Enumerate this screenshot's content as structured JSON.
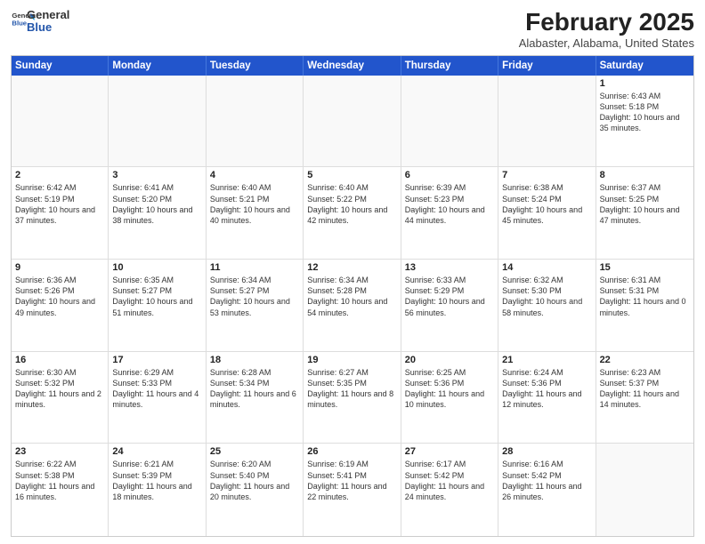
{
  "header": {
    "logo": {
      "general": "General",
      "blue": "Blue"
    },
    "title": "February 2025",
    "location": "Alabaster, Alabama, United States"
  },
  "calendar": {
    "weekdays": [
      "Sunday",
      "Monday",
      "Tuesday",
      "Wednesday",
      "Thursday",
      "Friday",
      "Saturday"
    ],
    "rows": [
      [
        {
          "day": "",
          "sunrise": "",
          "sunset": "",
          "daylight": ""
        },
        {
          "day": "",
          "sunrise": "",
          "sunset": "",
          "daylight": ""
        },
        {
          "day": "",
          "sunrise": "",
          "sunset": "",
          "daylight": ""
        },
        {
          "day": "",
          "sunrise": "",
          "sunset": "",
          "daylight": ""
        },
        {
          "day": "",
          "sunrise": "",
          "sunset": "",
          "daylight": ""
        },
        {
          "day": "",
          "sunrise": "",
          "sunset": "",
          "daylight": ""
        },
        {
          "day": "1",
          "sunrise": "Sunrise: 6:43 AM",
          "sunset": "Sunset: 5:18 PM",
          "daylight": "Daylight: 10 hours and 35 minutes."
        }
      ],
      [
        {
          "day": "2",
          "sunrise": "Sunrise: 6:42 AM",
          "sunset": "Sunset: 5:19 PM",
          "daylight": "Daylight: 10 hours and 37 minutes."
        },
        {
          "day": "3",
          "sunrise": "Sunrise: 6:41 AM",
          "sunset": "Sunset: 5:20 PM",
          "daylight": "Daylight: 10 hours and 38 minutes."
        },
        {
          "day": "4",
          "sunrise": "Sunrise: 6:40 AM",
          "sunset": "Sunset: 5:21 PM",
          "daylight": "Daylight: 10 hours and 40 minutes."
        },
        {
          "day": "5",
          "sunrise": "Sunrise: 6:40 AM",
          "sunset": "Sunset: 5:22 PM",
          "daylight": "Daylight: 10 hours and 42 minutes."
        },
        {
          "day": "6",
          "sunrise": "Sunrise: 6:39 AM",
          "sunset": "Sunset: 5:23 PM",
          "daylight": "Daylight: 10 hours and 44 minutes."
        },
        {
          "day": "7",
          "sunrise": "Sunrise: 6:38 AM",
          "sunset": "Sunset: 5:24 PM",
          "daylight": "Daylight: 10 hours and 45 minutes."
        },
        {
          "day": "8",
          "sunrise": "Sunrise: 6:37 AM",
          "sunset": "Sunset: 5:25 PM",
          "daylight": "Daylight: 10 hours and 47 minutes."
        }
      ],
      [
        {
          "day": "9",
          "sunrise": "Sunrise: 6:36 AM",
          "sunset": "Sunset: 5:26 PM",
          "daylight": "Daylight: 10 hours and 49 minutes."
        },
        {
          "day": "10",
          "sunrise": "Sunrise: 6:35 AM",
          "sunset": "Sunset: 5:27 PM",
          "daylight": "Daylight: 10 hours and 51 minutes."
        },
        {
          "day": "11",
          "sunrise": "Sunrise: 6:34 AM",
          "sunset": "Sunset: 5:27 PM",
          "daylight": "Daylight: 10 hours and 53 minutes."
        },
        {
          "day": "12",
          "sunrise": "Sunrise: 6:34 AM",
          "sunset": "Sunset: 5:28 PM",
          "daylight": "Daylight: 10 hours and 54 minutes."
        },
        {
          "day": "13",
          "sunrise": "Sunrise: 6:33 AM",
          "sunset": "Sunset: 5:29 PM",
          "daylight": "Daylight: 10 hours and 56 minutes."
        },
        {
          "day": "14",
          "sunrise": "Sunrise: 6:32 AM",
          "sunset": "Sunset: 5:30 PM",
          "daylight": "Daylight: 10 hours and 58 minutes."
        },
        {
          "day": "15",
          "sunrise": "Sunrise: 6:31 AM",
          "sunset": "Sunset: 5:31 PM",
          "daylight": "Daylight: 11 hours and 0 minutes."
        }
      ],
      [
        {
          "day": "16",
          "sunrise": "Sunrise: 6:30 AM",
          "sunset": "Sunset: 5:32 PM",
          "daylight": "Daylight: 11 hours and 2 minutes."
        },
        {
          "day": "17",
          "sunrise": "Sunrise: 6:29 AM",
          "sunset": "Sunset: 5:33 PM",
          "daylight": "Daylight: 11 hours and 4 minutes."
        },
        {
          "day": "18",
          "sunrise": "Sunrise: 6:28 AM",
          "sunset": "Sunset: 5:34 PM",
          "daylight": "Daylight: 11 hours and 6 minutes."
        },
        {
          "day": "19",
          "sunrise": "Sunrise: 6:27 AM",
          "sunset": "Sunset: 5:35 PM",
          "daylight": "Daylight: 11 hours and 8 minutes."
        },
        {
          "day": "20",
          "sunrise": "Sunrise: 6:25 AM",
          "sunset": "Sunset: 5:36 PM",
          "daylight": "Daylight: 11 hours and 10 minutes."
        },
        {
          "day": "21",
          "sunrise": "Sunrise: 6:24 AM",
          "sunset": "Sunset: 5:36 PM",
          "daylight": "Daylight: 11 hours and 12 minutes."
        },
        {
          "day": "22",
          "sunrise": "Sunrise: 6:23 AM",
          "sunset": "Sunset: 5:37 PM",
          "daylight": "Daylight: 11 hours and 14 minutes."
        }
      ],
      [
        {
          "day": "23",
          "sunrise": "Sunrise: 6:22 AM",
          "sunset": "Sunset: 5:38 PM",
          "daylight": "Daylight: 11 hours and 16 minutes."
        },
        {
          "day": "24",
          "sunrise": "Sunrise: 6:21 AM",
          "sunset": "Sunset: 5:39 PM",
          "daylight": "Daylight: 11 hours and 18 minutes."
        },
        {
          "day": "25",
          "sunrise": "Sunrise: 6:20 AM",
          "sunset": "Sunset: 5:40 PM",
          "daylight": "Daylight: 11 hours and 20 minutes."
        },
        {
          "day": "26",
          "sunrise": "Sunrise: 6:19 AM",
          "sunset": "Sunset: 5:41 PM",
          "daylight": "Daylight: 11 hours and 22 minutes."
        },
        {
          "day": "27",
          "sunrise": "Sunrise: 6:17 AM",
          "sunset": "Sunset: 5:42 PM",
          "daylight": "Daylight: 11 hours and 24 minutes."
        },
        {
          "day": "28",
          "sunrise": "Sunrise: 6:16 AM",
          "sunset": "Sunset: 5:42 PM",
          "daylight": "Daylight: 11 hours and 26 minutes."
        },
        {
          "day": "",
          "sunrise": "",
          "sunset": "",
          "daylight": ""
        }
      ]
    ]
  }
}
